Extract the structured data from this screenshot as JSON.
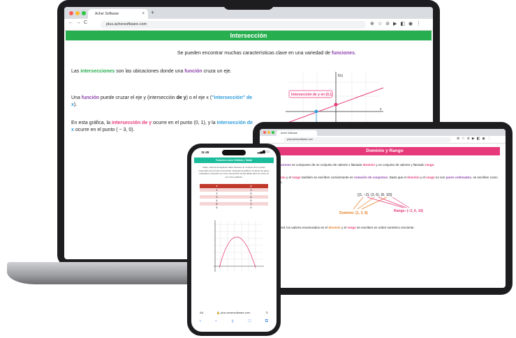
{
  "laptop": {
    "tab_title": "Acher Software",
    "url": "plus.achersoftware.com",
    "page_title": "Intersección",
    "intro": {
      "pre": "Se pueden encontrar muchas características clave en una variedad de ",
      "link": "funciones",
      "post": "."
    },
    "p1": {
      "a": "Las ",
      "b": "intersecciones",
      "c": " son las ubicaciones donde una ",
      "d": "función",
      "e": " cruza un eje."
    },
    "p2": {
      "a": "Una ",
      "b": "función",
      "c": " puede cruzar el eje y (intersección ",
      "d": "de y",
      "e": ") o el eje x (",
      "f": "\"intersección\" de x",
      "g": ")."
    },
    "p3": {
      "a": "En esta gráfica, la ",
      "b": "intersección de y",
      "c": " ocurre en el punto (0, 1), y la ",
      "d": "intersección de x",
      "e": " ocurre en el punto ( − 3, 0)."
    },
    "graph": {
      "label": "Intersección de y en (0,1)",
      "fx": "f(x)",
      "x": "x"
    }
  },
  "tablet": {
    "tab_title": "Acher Software",
    "url": "plus.achersoftware.com",
    "page_title": "Dominio y Rango",
    "line1": {
      "a": "Las ",
      "b": "relaciones",
      "c": " se componen de un conjunto de valores x llamado ",
      "d": "dominio",
      "e": " y un conjunto de valores y llamado ",
      "f": "rango",
      "g": "."
    },
    "line2": {
      "a": "El ",
      "b": "dominio",
      "c": " y el ",
      "d": "rango",
      "e": " también se escriben comúnmente en ",
      "f": "notación de conjuntos",
      "g": ". Dado que el ",
      "h": "dominio",
      "i": " y el ",
      "j": "rango",
      "k": " no son ",
      "l": "pares ordenados",
      "m": ", se escriben como números."
    },
    "set": "{(1, −2), (3, 6), (8, 10)}",
    "domain": "Dominio: {1, 3, 8}",
    "range": "Rango: {−2, 6, 10}",
    "line3": {
      "a": "En general, los valores enumerados en el ",
      "b": "dominio",
      "c": " y el ",
      "d": "rango",
      "e": " se escriben en orden numérico creciente."
    }
  },
  "phone": {
    "time": "11:45",
    "title": "Funciones como Gráficas y Tablas",
    "text": "Abajo, observa la siguiente tabla. Muestra un conjunto de ten pares ordenados que forman una función. Después la gráfica a conjunto los pares ordenados y hacerlos ver como una función de las tablas para ver cómo se ven como gráficas.",
    "table_header": [
      "x",
      "y"
    ],
    "table_rows": [
      [
        "1",
        "3"
      ],
      [
        "2",
        "5"
      ],
      [
        "3",
        "6"
      ],
      [
        "4",
        "5"
      ],
      [
        "5",
        "3"
      ],
      [
        "6",
        "0"
      ]
    ],
    "url": "plus.achersoftware.com",
    "aa": "AA"
  },
  "colors": {
    "green": "#27ae4f",
    "pink": "#e6397a",
    "purple": "#8e44ad",
    "blue": "#2d9cdb",
    "orange": "#e67e22",
    "teal": "#1abc9c"
  }
}
